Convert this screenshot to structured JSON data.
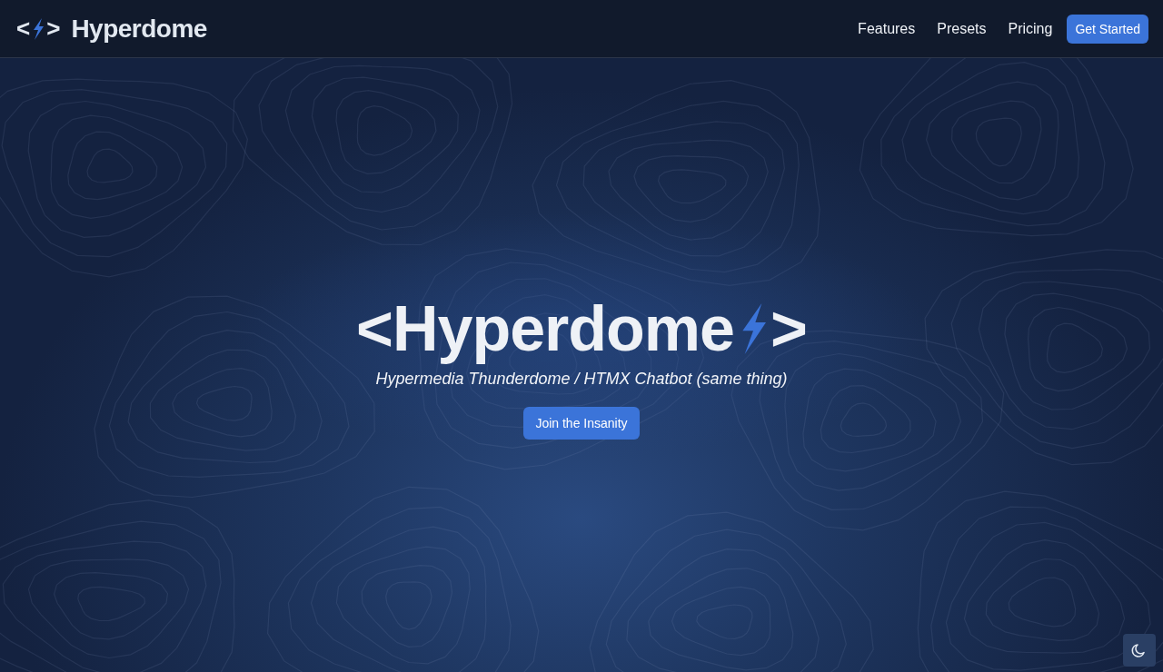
{
  "nav": {
    "logo": {
      "open": "<",
      "close": ">",
      "name": "Hyperdome"
    },
    "links": [
      {
        "label": "Features"
      },
      {
        "label": "Presets"
      },
      {
        "label": "Pricing"
      }
    ],
    "cta": "Get Started"
  },
  "hero": {
    "title_open": "<Hyperdome",
    "title_close": ">",
    "subtitle": "Hypermedia Thunderdome / HTMX Chatbot (same thing)",
    "button": "Join the Insanity"
  }
}
